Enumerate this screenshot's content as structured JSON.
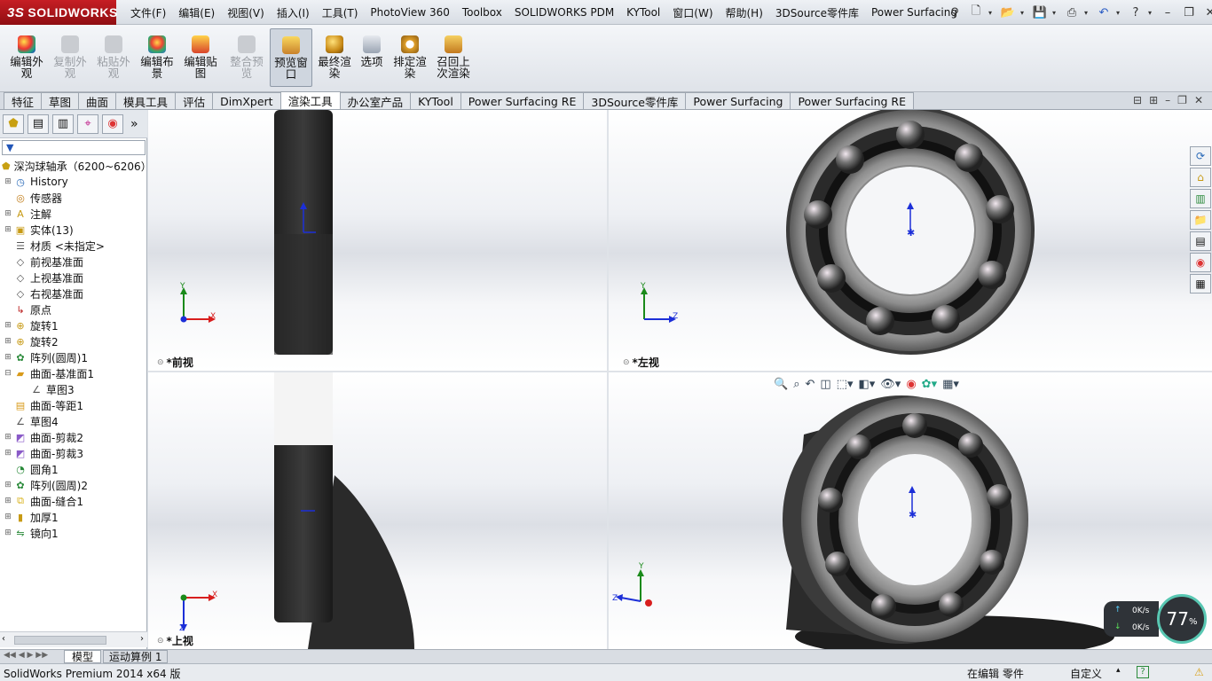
{
  "app": {
    "logo_text": "SOLIDWORKS",
    "logo_prefix": "3S"
  },
  "menu": [
    "文件(F)",
    "编辑(E)",
    "视图(V)",
    "插入(I)",
    "工具(T)",
    "PhotoView 360",
    "Toolbox",
    "SOLIDWORKS PDM",
    "KYTool",
    "窗口(W)",
    "帮助(H)",
    "3DSource零件库",
    "Power Surfacing"
  ],
  "commands": [
    {
      "label": "编辑外观",
      "state": "enabled"
    },
    {
      "label": "复制外观",
      "state": "disabled"
    },
    {
      "label": "粘贴外观",
      "state": "disabled"
    },
    {
      "label": "编辑布景",
      "state": "enabled"
    },
    {
      "label": "编辑贴图",
      "state": "enabled"
    },
    {
      "label": "整合预览",
      "state": "disabled"
    },
    {
      "label": "预览窗口",
      "state": "active"
    },
    {
      "label": "最终渲染",
      "state": "enabled"
    },
    {
      "label": "选项",
      "state": "enabled"
    },
    {
      "label": "排定渲染",
      "state": "enabled"
    },
    {
      "label": "召回上次渲染",
      "state": "enabled"
    }
  ],
  "tabs": [
    "特征",
    "草图",
    "曲面",
    "模具工具",
    "评估",
    "DimXpert",
    "渲染工具",
    "办公室产品",
    "KYTool",
    "Power Surfacing RE",
    "3DSource零件库",
    "Power Surfacing",
    "Power Surfacing RE"
  ],
  "active_tab": "渲染工具",
  "tree": {
    "root": "深沟球轴承（6200~6206）",
    "items": [
      {
        "label": "History",
        "icon": "history-icon",
        "expand": true
      },
      {
        "label": "传感器",
        "icon": "sensor-icon",
        "expand": false
      },
      {
        "label": "注解",
        "icon": "annotation-icon",
        "expand": true
      },
      {
        "label": "实体(13)",
        "icon": "solid-bodies-icon",
        "expand": true
      },
      {
        "label": "材质 <未指定>",
        "icon": "material-icon",
        "expand": false
      },
      {
        "label": "前视基准面",
        "icon": "plane-icon",
        "expand": false
      },
      {
        "label": "上视基准面",
        "icon": "plane-icon",
        "expand": false
      },
      {
        "label": "右视基准面",
        "icon": "plane-icon",
        "expand": false
      },
      {
        "label": "原点",
        "icon": "origin-icon",
        "expand": false
      },
      {
        "label": "旋转1",
        "icon": "revolve-icon",
        "expand": true
      },
      {
        "label": "旋转2",
        "icon": "revolve-icon",
        "expand": true
      },
      {
        "label": "阵列(圆周)1",
        "icon": "circular-pattern-icon",
        "expand": true
      },
      {
        "label": "曲面-基准面1",
        "icon": "planar-surface-icon",
        "expand": true,
        "open": true
      },
      {
        "label": "草图3",
        "icon": "sketch-icon",
        "expand": false,
        "child": true
      },
      {
        "label": "曲面-等距1",
        "icon": "offset-surface-icon",
        "expand": false
      },
      {
        "label": "草图4",
        "icon": "sketch-icon",
        "expand": false
      },
      {
        "label": "曲面-剪裁2",
        "icon": "trim-surface-icon",
        "expand": true
      },
      {
        "label": "曲面-剪裁3",
        "icon": "trim-surface-icon",
        "expand": true
      },
      {
        "label": "圆角1",
        "icon": "fillet-icon",
        "expand": false
      },
      {
        "label": "阵列(圆周)2",
        "icon": "circular-pattern-icon",
        "expand": true
      },
      {
        "label": "曲面-缝合1",
        "icon": "knit-surface-icon",
        "expand": true
      },
      {
        "label": "加厚1",
        "icon": "thicken-icon",
        "expand": true
      },
      {
        "label": "镜向1",
        "icon": "mirror-icon",
        "expand": true
      }
    ]
  },
  "viewports": {
    "front": "*前视",
    "left": "*左视",
    "top": "*上视"
  },
  "axes": {
    "x": "X",
    "y": "Y",
    "z": "Z"
  },
  "bottom_tabs": [
    "模型",
    "运动算例 1"
  ],
  "status": {
    "left": "SolidWorks Premium 2014 x64 版",
    "mode": "在编辑 零件",
    "units": "自定义"
  },
  "perf": {
    "up": "0K/s",
    "down": "0K/s",
    "percent": "77",
    "percent_unit": "%"
  },
  "colors": {
    "brand": "#b51a20",
    "axis_x": "#d81e1e",
    "axis_y": "#1a8a1a",
    "axis_z": "#1c2fd8"
  }
}
